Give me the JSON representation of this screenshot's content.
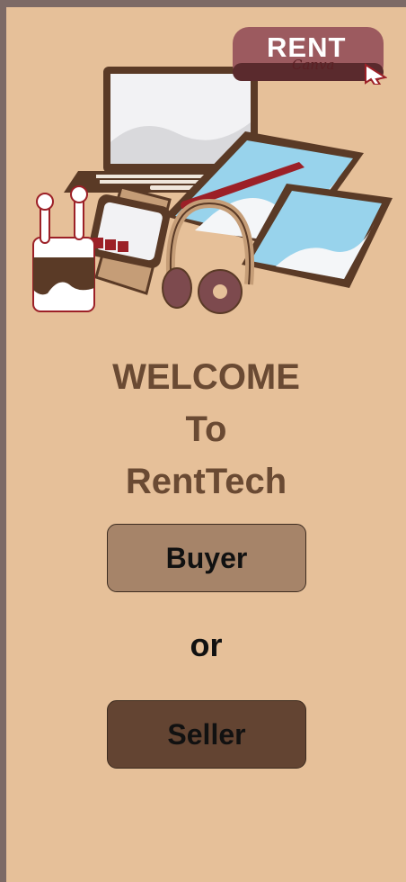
{
  "logo": {
    "word": "RENT",
    "sub": "Canva"
  },
  "welcome": {
    "line1": "WELCOME",
    "line2": "To",
    "line3": "RentTech"
  },
  "actions": {
    "buyer_label": "Buyer",
    "or_label": "or",
    "seller_label": "Seller"
  },
  "colors": {
    "background": "#e6c099",
    "frame": "#7d6a66",
    "heading": "#6a4a33",
    "buyer_button": "#a68469",
    "seller_button": "#634432",
    "brand_red": "#9c2027"
  },
  "icons": [
    "laptop-icon",
    "tablet-icon",
    "phone-icon",
    "earbuds-icon",
    "smartwatch-icon",
    "headphones-icon",
    "cursor-icon"
  ]
}
